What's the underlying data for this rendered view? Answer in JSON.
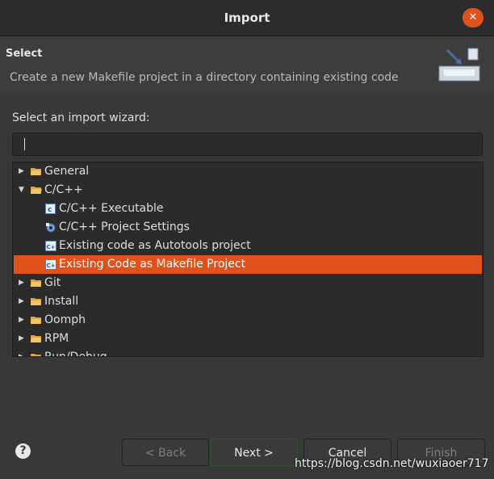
{
  "window": {
    "title": "Import",
    "close_icon": "close-icon"
  },
  "header": {
    "title": "Select",
    "description": "Create a new Makefile project in a directory containing existing code",
    "banner_icon": "import-wizard-icon"
  },
  "filter": {
    "label": "Select an import wizard:",
    "value": "",
    "placeholder": ""
  },
  "tree": {
    "items": [
      {
        "label": "General",
        "icon": "folder-icon",
        "expanded": false,
        "level": 0
      },
      {
        "label": "C/C++",
        "icon": "folder-icon",
        "expanded": true,
        "level": 0
      },
      {
        "label": "C/C++ Executable",
        "icon": "c-file-icon",
        "level": 1
      },
      {
        "label": "C/C++ Project Settings",
        "icon": "settings-icon",
        "level": 1
      },
      {
        "label": "Existing code as Autotools project",
        "icon": "cpp-project-icon",
        "level": 1
      },
      {
        "label": "Existing Code as Makefile Project",
        "icon": "cpp-project-icon",
        "level": 1,
        "selected": true
      },
      {
        "label": "Git",
        "icon": "folder-icon",
        "expanded": false,
        "level": 0
      },
      {
        "label": "Install",
        "icon": "folder-icon",
        "expanded": false,
        "level": 0
      },
      {
        "label": "Oomph",
        "icon": "folder-icon",
        "expanded": false,
        "level": 0
      },
      {
        "label": "RPM",
        "icon": "folder-icon",
        "expanded": false,
        "level": 0
      },
      {
        "label": "Run/Debug",
        "icon": "folder-icon",
        "expanded": false,
        "level": 0
      }
    ]
  },
  "buttons": {
    "back": "< Back",
    "next": "Next >",
    "cancel": "Cancel",
    "finish": "Finish"
  },
  "help": "?",
  "watermark": "https://blog.csdn.net/wuxiaoer717",
  "colors": {
    "accent": "#e0511c",
    "background": "#383838",
    "field": "#2b2b2b"
  }
}
